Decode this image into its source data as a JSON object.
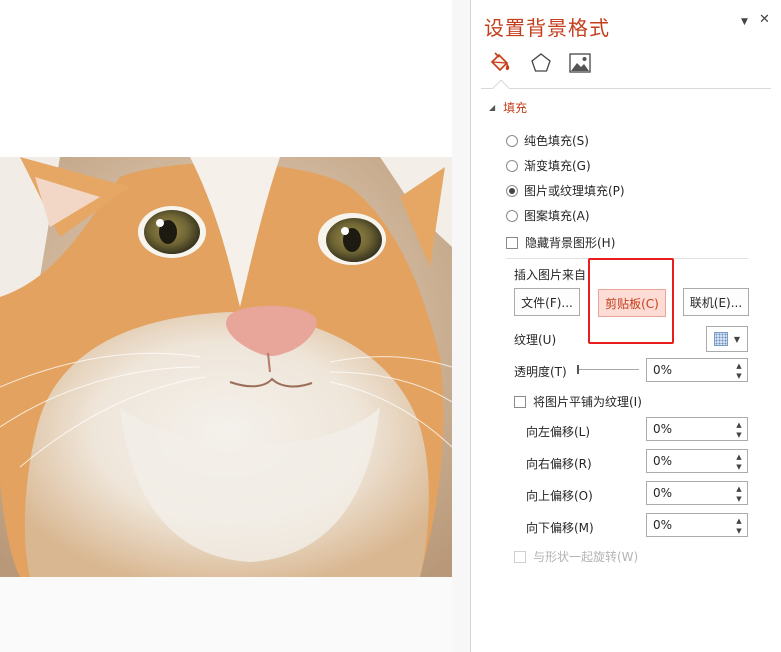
{
  "pane": {
    "title": "设置背景格式",
    "dropdown_glyph": "▼",
    "close_glyph": "✕",
    "tabs": [
      {
        "icon": "paint-bucket-icon",
        "active": true
      },
      {
        "icon": "pentagon-icon",
        "active": false
      },
      {
        "icon": "picture-icon",
        "active": false
      }
    ],
    "accent_color": "#c43e1c"
  },
  "fill": {
    "section_title": "填充",
    "section_toggle_glyph": "◢",
    "options": [
      {
        "label": "纯色填充(S)",
        "selected": false
      },
      {
        "label": "渐变填充(G)",
        "selected": false
      },
      {
        "label": "图片或纹理填充(P)",
        "selected": true
      },
      {
        "label": "图案填充(A)",
        "selected": false
      }
    ],
    "hide_bg_graphics_label": "隐藏背景图形(H)",
    "insert_from_label": "插入图片来自",
    "buttons": {
      "file": "文件(F)...",
      "clipboard": "剪贴板(C)",
      "online": "联机(E)..."
    },
    "texture_label": "纹理(U)",
    "texture_caret": "▼",
    "transparency_label": "透明度(T)",
    "transparency_value": "0%",
    "tile_label": "将图片平铺为纹理(I)",
    "offsets": [
      {
        "label": "向左偏移(L)",
        "value": "0%"
      },
      {
        "label": "向右偏移(R)",
        "value": "0%"
      },
      {
        "label": "向上偏移(O)",
        "value": "0%"
      },
      {
        "label": "向下偏移(M)",
        "value": "0%"
      }
    ],
    "rotate_with_shape_label": "与形状一起旋转(W)",
    "spin_up_glyph": "▲",
    "spin_down_glyph": "▼"
  },
  "highlight_color": "#e81d1d"
}
